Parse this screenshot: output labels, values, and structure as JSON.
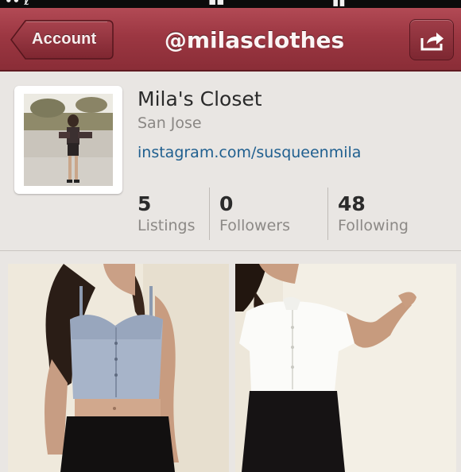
{
  "nav": {
    "back_label": "Account",
    "title": "@milasclothes"
  },
  "profile": {
    "name": "Mila's Closet",
    "location": "San Jose",
    "link": "instagram.com/susqueenmila"
  },
  "stats": [
    {
      "value": "5",
      "label": "Listings"
    },
    {
      "value": "0",
      "label": "Followers"
    },
    {
      "value": "48",
      "label": "Following"
    }
  ],
  "listings": [
    {
      "image": "denim-bustier-crop-top-photo"
    },
    {
      "image": "white-button-shirt-photo"
    }
  ],
  "colors": {
    "nav": "#9c3742",
    "link": "#1f5f8f",
    "background": "#e9e6e3"
  }
}
